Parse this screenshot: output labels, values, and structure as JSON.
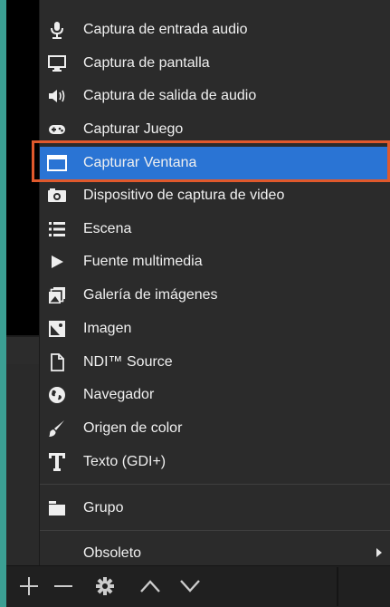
{
  "menu": {
    "items": [
      {
        "label": "Captura de entrada audio",
        "icon": "microphone-icon"
      },
      {
        "label": "Captura de pantalla",
        "icon": "monitor-icon"
      },
      {
        "label": "Captura de salida de audio",
        "icon": "speaker-icon"
      },
      {
        "label": "Capturar Juego",
        "icon": "gamepad-icon"
      },
      {
        "label": "Capturar Ventana",
        "icon": "window-icon"
      },
      {
        "label": "Dispositivo de captura de video",
        "icon": "camera-icon"
      },
      {
        "label": "Escena",
        "icon": "list-icon"
      },
      {
        "label": "Fuente multimedia",
        "icon": "play-icon"
      },
      {
        "label": "Galería de imágenes",
        "icon": "gallery-icon"
      },
      {
        "label": "Imagen",
        "icon": "image-icon"
      },
      {
        "label": "NDI™ Source",
        "icon": "file-icon"
      },
      {
        "label": "Navegador",
        "icon": "globe-icon"
      },
      {
        "label": "Origen de color",
        "icon": "brush-icon"
      },
      {
        "label": "Texto (GDI+)",
        "icon": "text-icon"
      },
      {
        "label": "Grupo",
        "icon": "folder-icon"
      },
      {
        "label": "Obsoleto",
        "icon": "submenu-arrow-icon"
      }
    ],
    "selected": "Capturar Ventana",
    "accent": "#2a74d4",
    "highlight_border": "#e0592c"
  },
  "toolbar": {
    "buttons": [
      "add-icon",
      "remove-icon",
      "gear-icon",
      "move-up-icon",
      "move-down-icon"
    ]
  }
}
